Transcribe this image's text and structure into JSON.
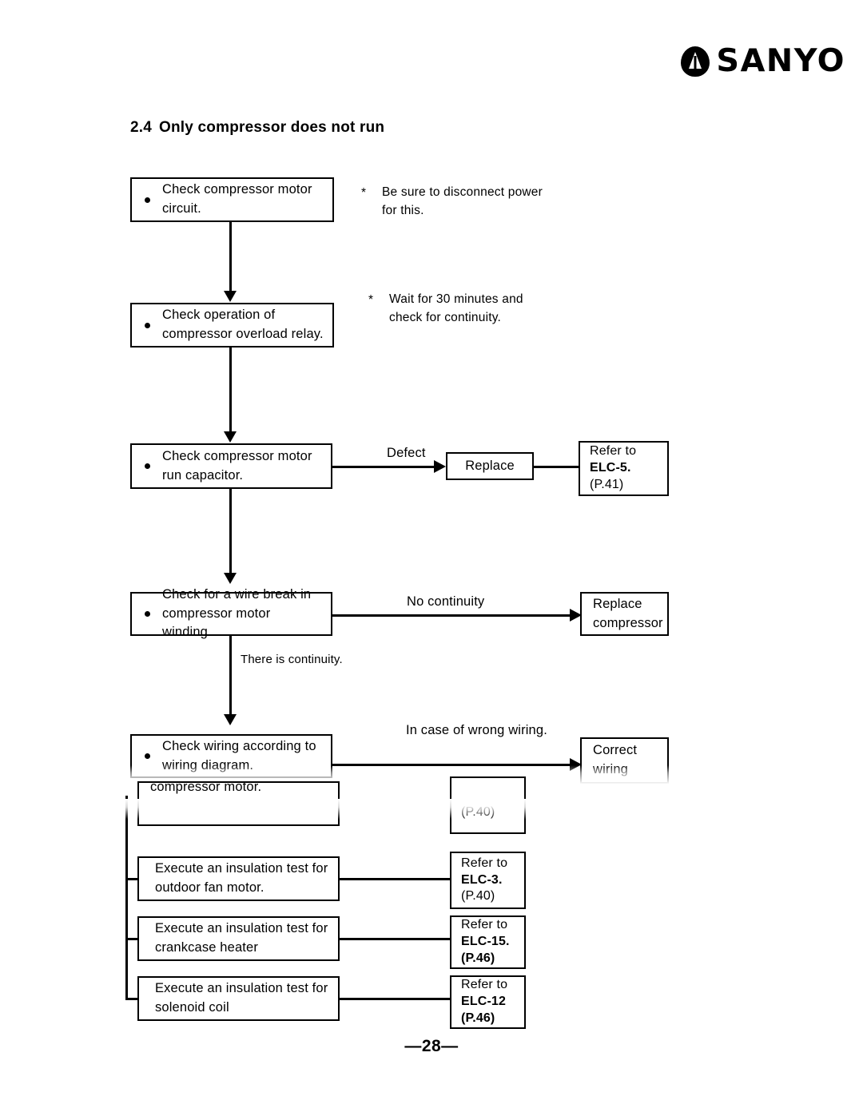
{
  "brand": {
    "name": "SANYO",
    "logo_icon": "sanyo-leaf-icon"
  },
  "section": {
    "number": "2.4",
    "title": "Only compressor does not run"
  },
  "flow": {
    "steps": [
      {
        "id": "check-compressor-motor-circuit",
        "text": "Check compressor motor circuit.",
        "note": {
          "marker": "*",
          "text": "Be sure to disconnect power for this."
        }
      },
      {
        "id": "check-overload-relay",
        "text": "Check operation of compressor overload relay.",
        "note": {
          "marker": "*",
          "text": "Wait for 30 minutes and check for continuity."
        }
      },
      {
        "id": "check-run-capacitor",
        "text": "Check compressor motor run capacitor.",
        "branch_label": "Defect",
        "action": "Replace",
        "reference": {
          "line1": "Refer to",
          "line2": "ELC-5.",
          "line3": "(P.41)"
        }
      },
      {
        "id": "check-wire-break",
        "text": "Check for a wire break in compressor motor winding.",
        "branch_label": "No continuity",
        "action": "Replace compressor",
        "continue_label": "There is continuity."
      },
      {
        "id": "check-wiring-diagram",
        "text": "Check wiring according to wiring diagram.",
        "branch_label": "In case of wrong wiring.",
        "action": "Correct wiring"
      }
    ],
    "insulation_tests": [
      {
        "id": "insulation-test-compressor-motor",
        "text": "compressor motor.",
        "reference": {
          "line1": "",
          "line2": "",
          "line3": "(P.40)"
        }
      },
      {
        "id": "insulation-test-outdoor-fan-motor",
        "text": "Execute an insulation test for outdoor fan motor.",
        "reference": {
          "line1": "Refer to",
          "line2": "ELC-3.",
          "line3": "(P.40)"
        }
      },
      {
        "id": "insulation-test-crankcase-heater",
        "text": "Execute an insulation test for crankcase heater",
        "reference": {
          "line1": "Refer to",
          "line2": "ELC-15.",
          "line3": "(P.46)"
        }
      },
      {
        "id": "insulation-test-solenoid-coil",
        "text": "Execute an insulation test for solenoid coil",
        "reference": {
          "line1": "Refer to",
          "line2": "ELC-12",
          "line3": "(P.46)"
        }
      }
    ]
  },
  "footer": {
    "page_number": "—28—"
  }
}
